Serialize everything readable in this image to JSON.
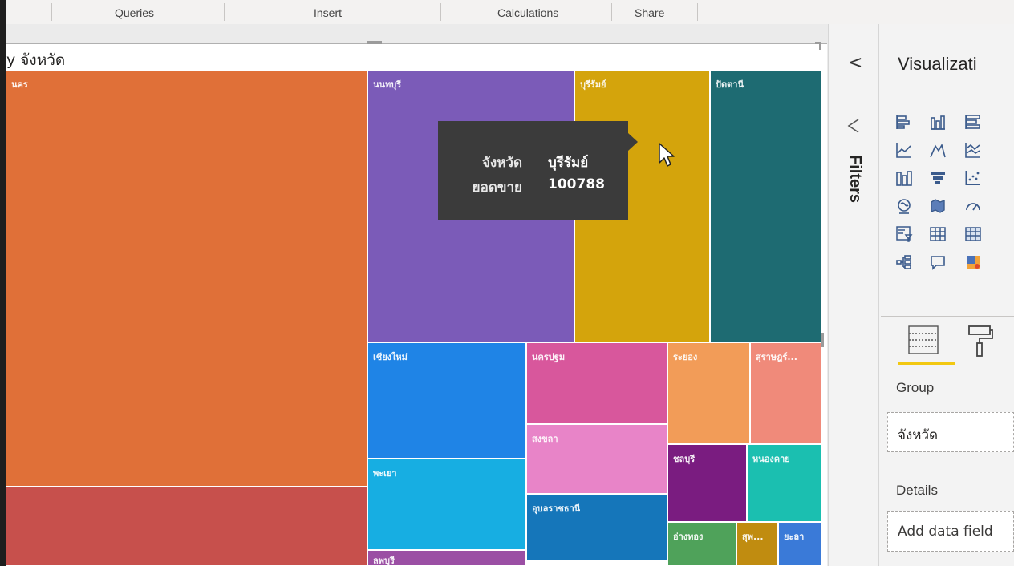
{
  "ribbon": {
    "groups": [
      "Queries",
      "Insert",
      "Calculations",
      "Share"
    ]
  },
  "visual": {
    "title": "y จังหวัด"
  },
  "chart_data": {
    "type": "treemap",
    "title": "y จังหวัด",
    "tiles": [
      {
        "label": "นคร",
        "color": "#e07038"
      },
      {
        "label": "",
        "color": "#c7504c"
      },
      {
        "label": "นนทบุรี",
        "color": "#7b5bb8"
      },
      {
        "label": "บุรีรัมย์",
        "color": "#d4a40c",
        "value": 100788
      },
      {
        "label": "ปัตตานี",
        "color": "#1e6b72"
      },
      {
        "label": "เชียงใหม่",
        "color": "#1f84e6"
      },
      {
        "label": "นครปฐม",
        "color": "#d8579c"
      },
      {
        "label": "ระยอง",
        "color": "#f29c58"
      },
      {
        "label": "สุราษฎร์...",
        "color": "#f08a7a"
      },
      {
        "label": "พะเยา",
        "color": "#17aee2"
      },
      {
        "label": "สงขลา",
        "color": "#e884c8"
      },
      {
        "label": "ชลบุรี",
        "color": "#7a1c80"
      },
      {
        "label": "หนองคาย",
        "color": "#1bbfb0"
      },
      {
        "label": "อุบลราชธานี",
        "color": "#1576ba"
      },
      {
        "label": "อ่างทอง",
        "color": "#4fa25a"
      },
      {
        "label": "สุพ...",
        "color": "#c08c10"
      },
      {
        "label": "ยะลา",
        "color": "#3a7ad8"
      },
      {
        "label": "ลพบุรี",
        "color": "#9b4fa4"
      }
    ]
  },
  "tooltip": {
    "rows": [
      {
        "key": "จังหวัด",
        "value": "บุรีรัมย์"
      },
      {
        "key": "ยอดขาย",
        "value": "100788"
      }
    ]
  },
  "filters_pane": {
    "collapse_glyph": "<",
    "label": "Filters",
    "icon": "filter-icon"
  },
  "viz_pane": {
    "title": "Visualizati",
    "icons": [
      "stacked-bar-chart-icon",
      "clustered-column-chart-icon",
      "stacked-bar-100-icon",
      "line-chart-icon",
      "area-chart-icon",
      "stacked-area-chart-icon",
      "ribbon-chart-icon",
      "funnel-chart-icon",
      "scatter-chart-icon",
      "map-icon",
      "filled-map-icon",
      "gauge-icon",
      "slicer-icon",
      "table-icon",
      "matrix-icon",
      "decomposition-tree-icon",
      "qna-icon",
      "r-visual-icon"
    ],
    "group_label": "Group",
    "group_value": "จังหวัด",
    "details_label": "Details",
    "details_placeholder": "Add data field"
  }
}
